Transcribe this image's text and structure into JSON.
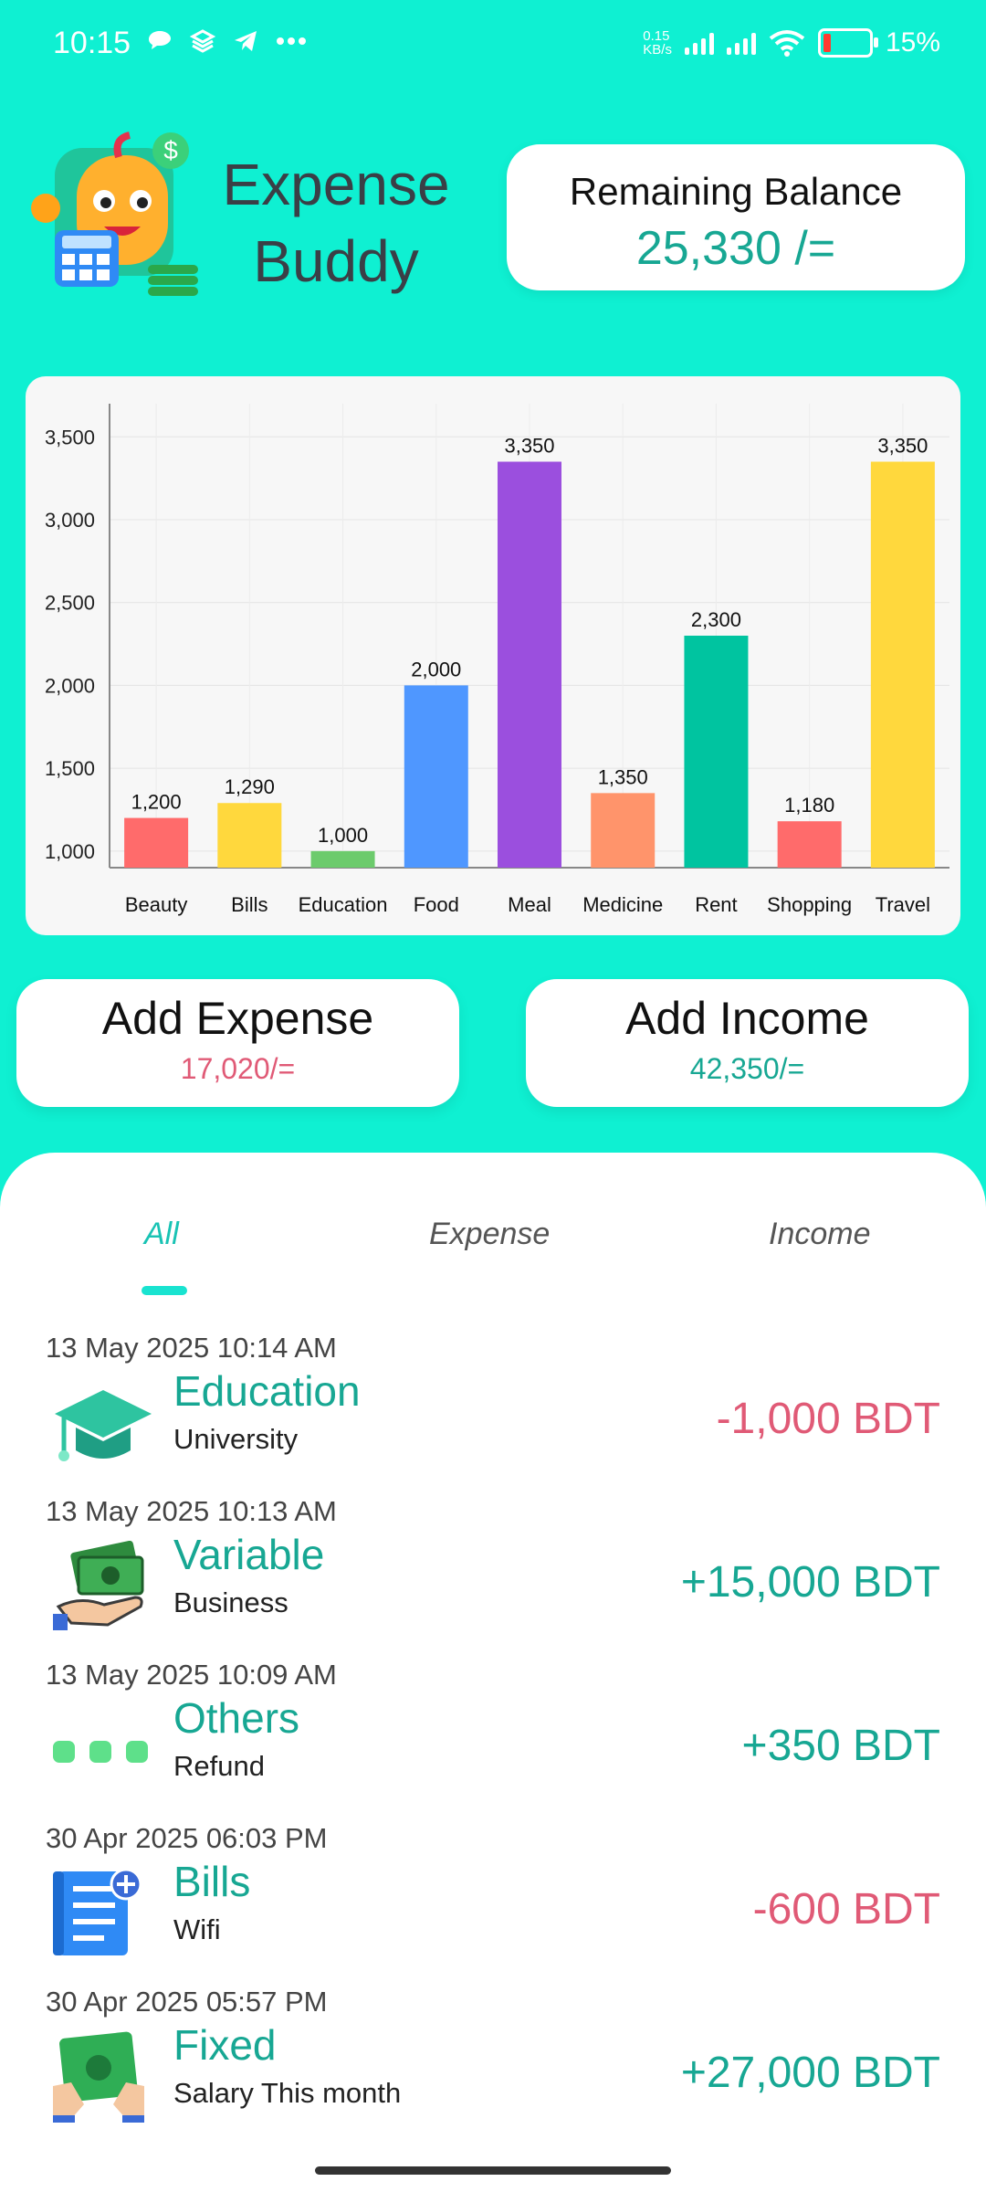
{
  "status_bar": {
    "time": "10:15",
    "speed_value": "0.15",
    "speed_unit": "KB/s",
    "battery": "15%"
  },
  "app": {
    "title_line1": "Expense",
    "title_line2": "Buddy"
  },
  "balance": {
    "label": "Remaining Balance",
    "value": "25,330 /="
  },
  "chart_data": {
    "type": "bar",
    "categories": [
      "Beauty",
      "Bills",
      "Education",
      "Food",
      "Meal",
      "Medicine",
      "Rent",
      "Shopping",
      "Travel"
    ],
    "values": [
      1200,
      1290,
      1000,
      2000,
      3350,
      1350,
      2300,
      1180,
      3350
    ],
    "value_labels": [
      "1,200",
      "1,290",
      "1,000",
      "2,000",
      "3,350",
      "1,350",
      "2,300",
      "1,180",
      "3,350"
    ],
    "colors": [
      "#ff6b6b",
      "#ffd83d",
      "#6ccb6c",
      "#4f97ff",
      "#9b4fde",
      "#ff946b",
      "#00c4a0",
      "#ff6b6b",
      "#ffd83d"
    ],
    "y_ticks": [
      "1,000",
      "1,500",
      "2,000",
      "2,500",
      "3,000",
      "3,500"
    ],
    "ylim": [
      900,
      3700
    ],
    "grid": true
  },
  "actions": {
    "expense": {
      "label": "Add Expense",
      "amount": "17,020/="
    },
    "income": {
      "label": "Add Income",
      "amount": "42,350/="
    }
  },
  "tabs": {
    "all": "All",
    "expense": "Expense",
    "income": "Income"
  },
  "transactions": [
    {
      "date": "13 May 2025 10:14 AM",
      "category": "Education",
      "note": "University",
      "amount": "-1,000 BDT",
      "icon": "graduation-cap-icon"
    },
    {
      "date": "13 May 2025 10:13 AM",
      "category": "Variable",
      "note": "Business",
      "amount": "+15,000 BDT",
      "icon": "cash-hand-icon"
    },
    {
      "date": "13 May 2025 10:09 AM",
      "category": "Others",
      "note": "Refund",
      "amount": "+350 BDT",
      "icon": "more-dots-icon"
    },
    {
      "date": "30 Apr 2025 06:03 PM",
      "category": "Bills",
      "note": "Wifi",
      "amount": "-600 BDT",
      "icon": "receipt-icon"
    },
    {
      "date": "30 Apr 2025 05:57 PM",
      "category": "Fixed",
      "note": "Salary This month",
      "amount": "+27,000 BDT",
      "icon": "salary-cash-icon"
    }
  ],
  "colors": {
    "background": "#0ff0d2",
    "accent_teal": "#17a793",
    "expense_red": "#e05a76"
  }
}
